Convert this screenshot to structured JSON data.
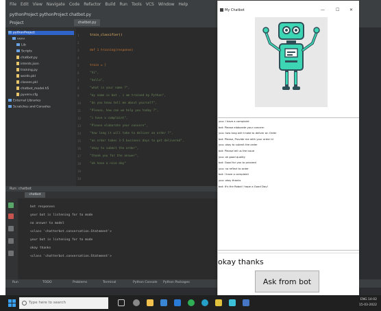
{
  "ide": {
    "menu": [
      "File",
      "Edit",
      "View",
      "Navigate",
      "Code",
      "Refactor",
      "Build",
      "Run",
      "Tools",
      "VCS",
      "Window",
      "Help"
    ],
    "breadcrumb": "pythonProject  pythonProject  chatbot.py",
    "project_label": "Project",
    "active_tab": "chatbot.py",
    "tree": [
      "pythonProject",
      "venv",
      "Lib",
      "Scripts",
      "chatbot.py",
      "intents.json",
      "training.py",
      "words.pkl",
      "classes.pkl",
      "chatbot_model.h5",
      "pyvenv.cfg",
      "External Libraries",
      "Scratches and Consoles"
    ],
    "line_numbers": [
      "1",
      "2",
      "3",
      "4",
      "5",
      "6",
      "7",
      "8",
      "9",
      "10",
      "11",
      "12",
      "13",
      "14",
      "15",
      "16",
      "17",
      "18",
      "19",
      "20"
    ],
    "code_lines": [
      "train_classifier()",
      "",
      "def 1 training(response)",
      "",
      "train = [",
      "    \"hi\",",
      "    \"hello\",",
      "    \"what is your name ?\",",
      "    \"my name is bot , i am trained by Python\",",
      "    \"do you know tell me about yourself\",",
      "    \"Please, how can we help you today ?\",",
      "    \"i have a complaint\",",
      "    \"Please elaborate your concern\",",
      "    \"how long it will take to deliver an order ?\",",
      "    \"an order takes 3-5 business days to get delivered\",",
      "    \"okay to submit the order\",",
      "    \"thank you for the answer\",",
      "    \"ok have a nice day\""
    ],
    "run_header": "Run:  chatbot",
    "run_tab": "chatbot",
    "console_lines": [
      "bot responses",
      "your bot is listening for to mode",
      "no answer to model",
      "<class 'chatterbot.conversation.Statement'>",
      "your bot is listening for to mode",
      "okay thanks",
      "<class 'chatterbot.conversation.Statement'>"
    ],
    "status_tabs": [
      "Run",
      "TODO",
      "Problems",
      "Terminal",
      "Python Console",
      "Python Packages"
    ]
  },
  "taskbar": {
    "search_placeholder": "Type here to search",
    "time": "14:02",
    "date": "15-03-2022",
    "tray_text": "ENG"
  },
  "bot": {
    "window_title": "My Chatbot",
    "controls": {
      "minimize": "—",
      "maximize": "☐",
      "close": "✕"
    },
    "messages": [
      "you: I have a complaint",
      "bot: Please elaborate your concern",
      "you: how long will it take to deliver an Order",
      "bot: Please, Provide me with your order id",
      "you: okay to submit the order",
      "bot: Please tell us the issue",
      "you: ok good quality",
      "bot: Good for you to proceed",
      "you: no reflect to order",
      "bot: I have a complaint",
      "you: okay thanks",
      "bot: It's the Robot I hope a Good Day!"
    ],
    "input_value": "okay thanks",
    "ask_button": "Ask from bot"
  },
  "colors": {
    "ide_bg": "#2b2b2b",
    "robot_teal": "#3dd6b5",
    "robot_dark": "#2f4f58",
    "selection": "#2f65ca"
  }
}
